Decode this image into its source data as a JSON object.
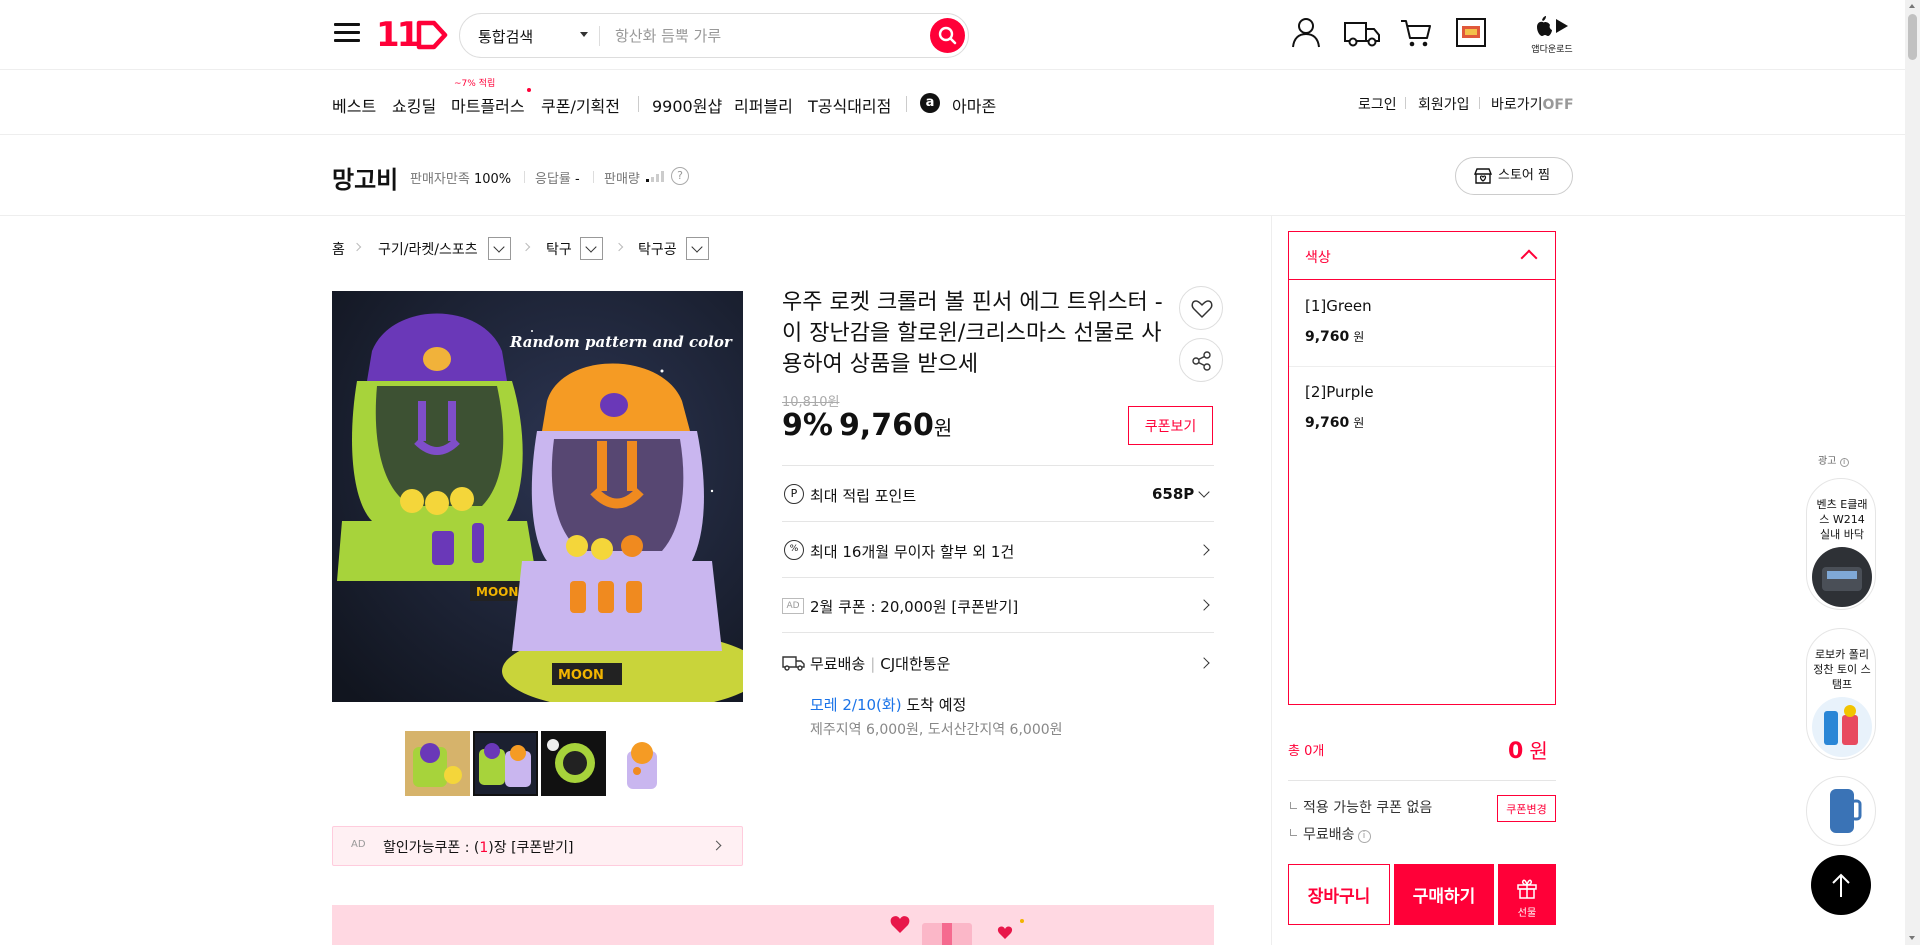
{
  "header": {
    "logo": "11",
    "search": {
      "category": "통합검색",
      "placeholder": "항산화 듬뿍 가루"
    },
    "icons": [
      "user-icon",
      "truck-icon",
      "cart-icon",
      "recent-icon",
      "app-store-icon"
    ],
    "app_download": "앱다운로드"
  },
  "nav": {
    "items": [
      "베스트",
      "쇼킹딜",
      "마트플러스",
      "쿠폰/기획전",
      "9900원샵",
      "리퍼블리",
      "T공식대리점",
      "아마존"
    ],
    "badge": "~7% 적립",
    "right": {
      "login": "로그인",
      "signup": "회원가입",
      "shortcut": "바로가기",
      "shortcut_state": "OFF"
    }
  },
  "seller": {
    "name": "망고비",
    "satisfaction_label": "판매자만족",
    "satisfaction_value": "100%",
    "response_label": "응답률",
    "response_value": "-",
    "sales_label": "판매량",
    "sales_level": 0.2,
    "help": "?",
    "store_button": "스토어 찜"
  },
  "breadcrumb": [
    "홈",
    "구기/라켓/스포츠",
    "탁구",
    "탁구공"
  ],
  "product": {
    "title": "우주 로켓 크롤러 볼 핀서 에그 트위스터 - 이 장난감을 할로윈/크리스마스 선물로 사용하여 상품을 받으세",
    "image_caption": "Random pattern and color",
    "original_price": "10,810원",
    "discount": "9%",
    "price": "9,760",
    "price_unit": "원",
    "coupon_view": "쿠폰보기",
    "points_label": "최대 적립 포인트",
    "points_value": "658P",
    "installment": "최대 16개월 무이자 할부 외 1건",
    "ad_tag": "AD",
    "coupon_offer": "2월 쿠폰 : 20,000원 [쿠폰받기]",
    "shipping": "무료배송",
    "carrier": "CJ대한통운",
    "delivery_day": "모레 2/10(화)",
    "delivery_suffix": "도착 예정",
    "delivery_extra": "제주지역 6,000원, 도서산간지역 6,000원",
    "discount_coupon_prefix": "할인가능쿠폰 : (",
    "discount_coupon_count": "1",
    "discount_coupon_suffix": ")장 [쿠폰받기]"
  },
  "options": {
    "header": "색상",
    "items": [
      {
        "name": "[1]Green",
        "price": "9,760",
        "unit": "원"
      },
      {
        "name": "[2]Purple",
        "price": "9,760",
        "unit": "원"
      }
    ],
    "total_label": "총 0개",
    "total_value": "0",
    "total_unit": "원",
    "coupon_status": "적용 가능한 쿠폰 없음",
    "change_coupon": "쿠폰변경",
    "free_shipping": "무료배송",
    "info": "i",
    "cart": "장바구니",
    "buy": "구매하기",
    "gift": "선물"
  },
  "side_ads": {
    "label": "광고",
    "cards": [
      {
        "text": "벤츠 E클래스 W214 실내 바닥"
      },
      {
        "text": "로보카 폴리 정찬 토이 스탬프"
      },
      {
        "text": ""
      }
    ]
  },
  "colors": {
    "brand": "#ff0038",
    "link": "#1a73e8"
  }
}
